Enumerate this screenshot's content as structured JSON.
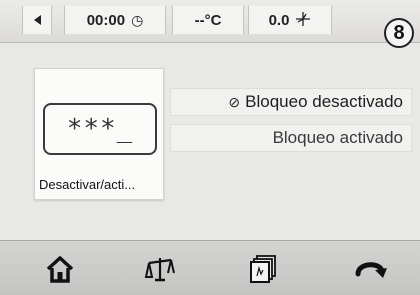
{
  "status_bar": {
    "time": "00:00",
    "temperature": "--°C",
    "fan_speed": "0.0",
    "step_number": "8"
  },
  "lock_tile": {
    "password_mask": "***_",
    "label": "Desactivar/acti..."
  },
  "options": [
    {
      "label": "Bloqueo desactivado",
      "selected": true
    },
    {
      "label": "Bloqueo activado",
      "selected": false
    }
  ],
  "icons": {
    "back": "back-arrow-icon",
    "clock": "clock-icon",
    "fan": "fan-icon",
    "home": "home-icon",
    "balance": "balance-icon",
    "cards": "cards-icon",
    "return": "return-icon"
  }
}
